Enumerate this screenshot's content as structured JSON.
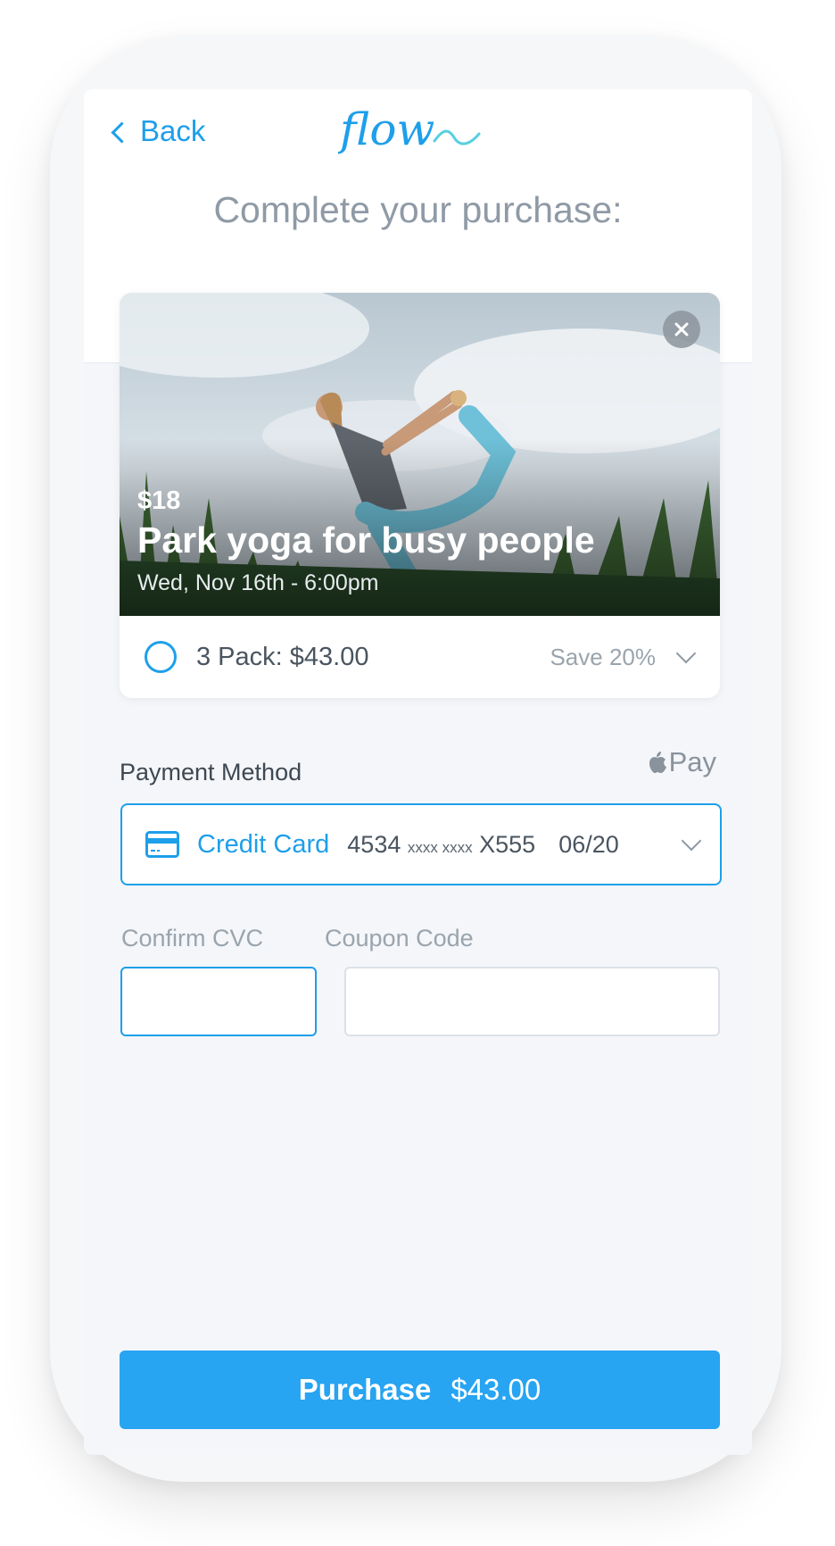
{
  "header": {
    "back_label": "Back",
    "logo_text": "flow",
    "title": "Complete your purchase:"
  },
  "event": {
    "price": "$18",
    "title": "Park yoga for busy people",
    "datetime": "Wed, Nov 16th - 6:00pm"
  },
  "pack_option": {
    "label": "3 Pack: $43.00",
    "save": "Save 20%"
  },
  "payment": {
    "label": "Payment Method",
    "apple_pay_label": "Pay",
    "method_label": "Credit Card",
    "card_first": "4534",
    "card_mask": "xxxx xxxx",
    "card_last": "X555",
    "expiry": "06/20"
  },
  "fields": {
    "cvc_label": "Confirm CVC",
    "coupon_label": "Coupon Code",
    "cvc_value": "",
    "coupon_value": ""
  },
  "purchase": {
    "label": "Purchase",
    "amount": "$43.00"
  },
  "colors": {
    "accent": "#1e9fea",
    "button": "#27a4f2",
    "muted_text": "#9aa4ad",
    "screen_bg": "#f4f6fa"
  },
  "icons": {
    "back": "chevron-left-icon",
    "close": "close-icon",
    "radio": "radio-unselected",
    "dropdown": "chevron-down-icon",
    "card": "credit-card-icon",
    "apple": "apple-logo-icon"
  }
}
